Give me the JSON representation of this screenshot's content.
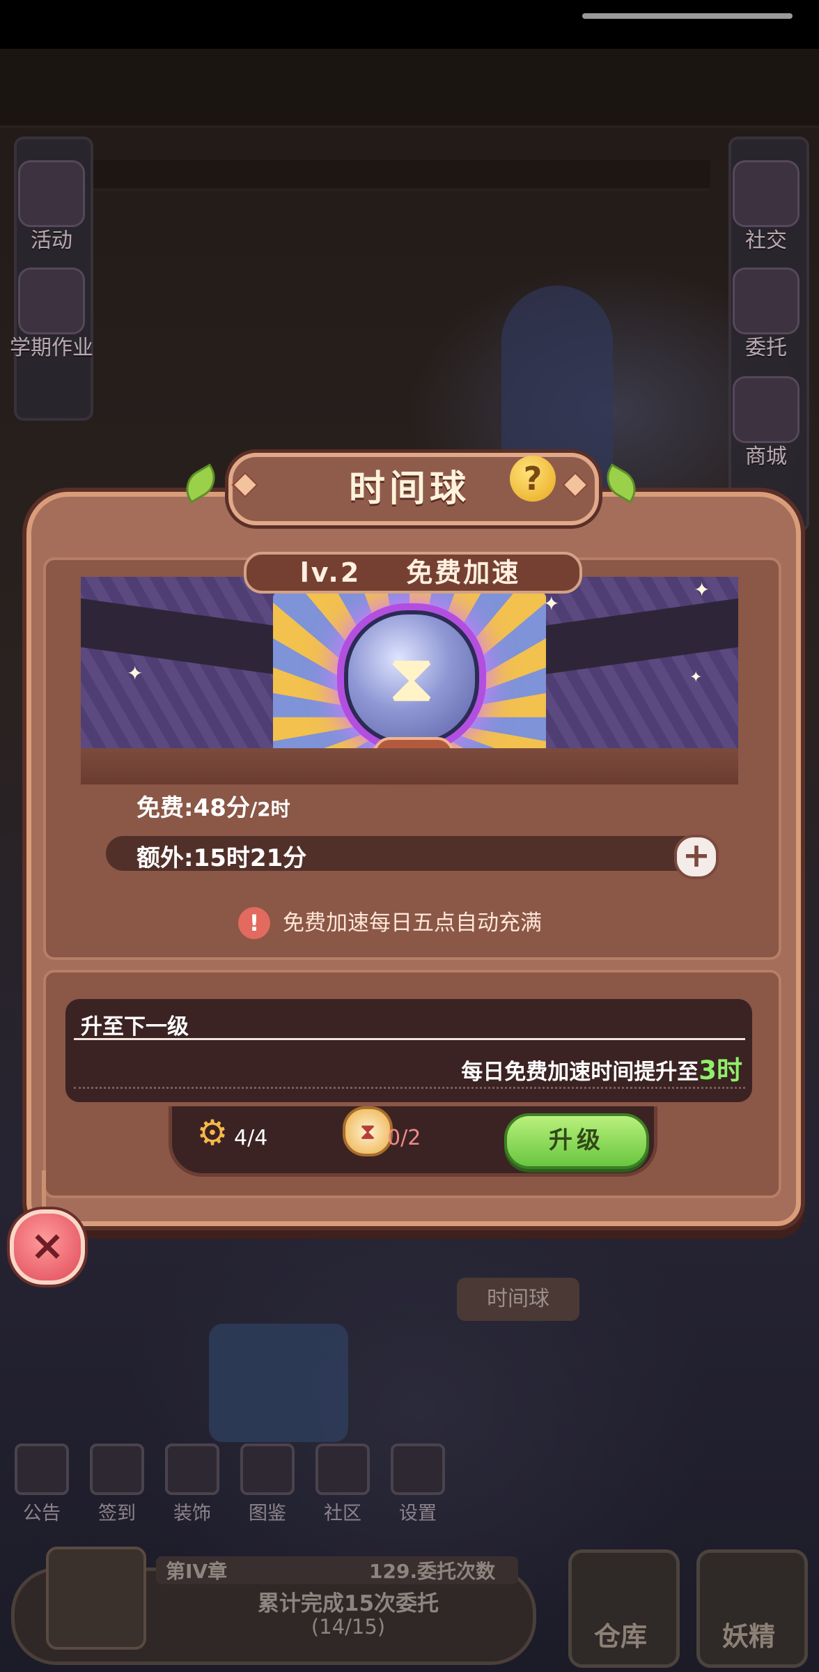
{
  "side_menu_left": [
    {
      "label": "活动",
      "icon": "activity-icon"
    },
    {
      "label": "学期作业",
      "icon": "homework-icon"
    }
  ],
  "side_menu_right": [
    {
      "label": "社交",
      "icon": "social-icon"
    },
    {
      "label": "委托",
      "icon": "commission-icon"
    },
    {
      "label": "商城",
      "icon": "shop-icon"
    }
  ],
  "dialog": {
    "title": "时间球",
    "help_glyph": "?",
    "level_badge": "lv.2",
    "level_label": "免费加速",
    "free_label": "免费:",
    "free_value": "48分",
    "free_max": "/2时",
    "extra_label": "额外:",
    "extra_value": "15时21分",
    "plus_glyph": "+",
    "notice": "免费加速每日五点自动充满",
    "next_level_title": "升至下一级",
    "next_level_desc": "每日免费加速时间提升至",
    "next_level_value": "3时",
    "gear_cost": "4/4",
    "clock_cost": "0/2",
    "upgrade_label": "升级",
    "close_glyph": "×"
  },
  "background": {
    "timeball_tag": "时间球",
    "bottom_menu": [
      {
        "label": "公告",
        "icon": "notice-board-icon"
      },
      {
        "label": "签到",
        "icon": "checkin-icon"
      },
      {
        "label": "装饰",
        "icon": "decoration-icon"
      },
      {
        "label": "图鉴",
        "icon": "catalog-icon"
      },
      {
        "label": "社区",
        "icon": "community-icon"
      },
      {
        "label": "设置",
        "icon": "settings-icon"
      }
    ],
    "chapter": "第IV章",
    "commission_count": "129.委托次数",
    "chapter_goal": "累计完成15次委托",
    "chapter_progress": "(14/15)",
    "warehouse_label": "仓库",
    "fairy_label": "妖精"
  },
  "colors": {
    "panel": "#a46e5b",
    "panel_border": "#d99d7a",
    "upgrade_green": "#69c640",
    "highlight_green": "#8ff06a",
    "close_red": "#e04a58"
  }
}
